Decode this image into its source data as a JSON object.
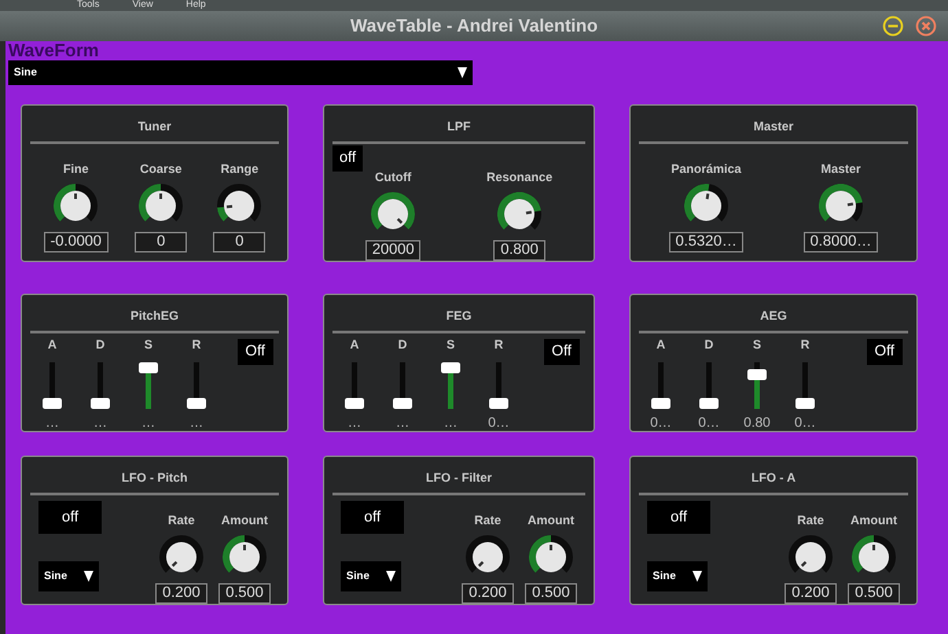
{
  "menu": [
    "Tools",
    "View",
    "Help"
  ],
  "window": {
    "title": "WaveTable - Andrei Valentino"
  },
  "waveform": {
    "label": "WaveForm",
    "value": "Sine"
  },
  "panels": [
    {
      "kind": "knobs",
      "title": "Tuner",
      "knobs": [
        {
          "label": "Fine",
          "level": 0.5,
          "value": "-0.0000"
        },
        {
          "label": "Coarse",
          "level": 0.5,
          "value": "0"
        },
        {
          "label": "Range",
          "level": 0.15,
          "value": "0"
        }
      ]
    },
    {
      "kind": "knobs",
      "title": "LPF",
      "toggle": "off",
      "knobs": [
        {
          "label": "Cutoff",
          "level": 1,
          "value": "20000"
        },
        {
          "label": "Resonance",
          "level": 0.8,
          "value": "0.800"
        }
      ]
    },
    {
      "kind": "knobs",
      "title": "Master",
      "knobs": [
        {
          "label": "Panorámica",
          "level": 0.53,
          "value": "0.5320…"
        },
        {
          "label": "Master",
          "level": 0.8,
          "value": "0.8000…"
        }
      ]
    },
    {
      "kind": "envelope",
      "title": "PitchEG",
      "toggle": "Off",
      "sliders": [
        {
          "label": "A",
          "level": 0,
          "value": "…"
        },
        {
          "label": "D",
          "level": 0,
          "value": "…"
        },
        {
          "label": "S",
          "level": 1,
          "value": "…"
        },
        {
          "label": "R",
          "level": 0,
          "value": "…"
        }
      ]
    },
    {
      "kind": "envelope",
      "title": "FEG",
      "toggle": "Off",
      "sliders": [
        {
          "label": "A",
          "level": 0,
          "value": "…"
        },
        {
          "label": "D",
          "level": 0,
          "value": "…"
        },
        {
          "label": "S",
          "level": 1,
          "value": "…"
        },
        {
          "label": "R",
          "level": 0,
          "value": "0…"
        }
      ]
    },
    {
      "kind": "envelope",
      "title": "AEG",
      "toggle": "Off",
      "sliders": [
        {
          "label": "A",
          "level": 0,
          "value": "0…"
        },
        {
          "label": "D",
          "level": 0,
          "value": "0…"
        },
        {
          "label": "S",
          "level": 0.8,
          "value": "0.80"
        },
        {
          "label": "R",
          "level": 0,
          "value": "0…"
        }
      ]
    },
    {
      "kind": "lfo",
      "title": "LFO - Pitch",
      "toggle": "off",
      "wave": "Sine",
      "knobs": [
        {
          "label": "Rate",
          "level": 0,
          "value": "0.200"
        },
        {
          "label": "Amount",
          "level": 0.5,
          "value": "0.500"
        }
      ]
    },
    {
      "kind": "lfo",
      "title": "LFO - Filter",
      "toggle": "off",
      "wave": "Sine",
      "knobs": [
        {
          "label": "Rate",
          "level": 0,
          "value": "0.200"
        },
        {
          "label": "Amount",
          "level": 0.5,
          "value": "0.500"
        }
      ]
    },
    {
      "kind": "lfo",
      "title": "LFO - A",
      "toggle": "off",
      "wave": "Sine",
      "knobs": [
        {
          "label": "Rate",
          "level": 0,
          "value": "0.200"
        },
        {
          "label": "Amount",
          "level": 0.5,
          "value": "0.500"
        }
      ]
    }
  ]
}
